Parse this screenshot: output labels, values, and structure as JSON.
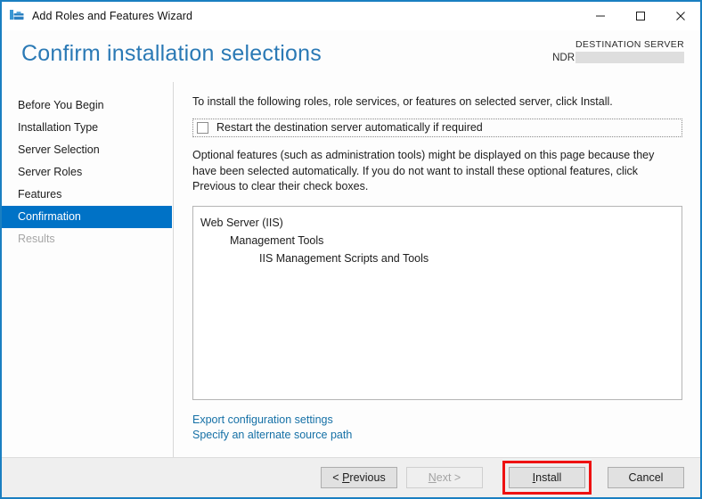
{
  "window": {
    "title": "Add Roles and Features Wizard",
    "icon": "roles-features-toolbox-icon",
    "accent_color": "#1a7fc1",
    "controls": {
      "minimize": "minimize-icon",
      "maximize": "maximize-icon",
      "close": "close-icon"
    }
  },
  "header": {
    "page_title": "Confirm installation selections",
    "destination_label": "DESTINATION SERVER",
    "destination_server": "NDR",
    "destination_redacted": true
  },
  "sidebar": {
    "items": [
      {
        "label": "Before You Begin",
        "state": "normal"
      },
      {
        "label": "Installation Type",
        "state": "normal"
      },
      {
        "label": "Server Selection",
        "state": "normal"
      },
      {
        "label": "Server Roles",
        "state": "normal"
      },
      {
        "label": "Features",
        "state": "normal"
      },
      {
        "label": "Confirmation",
        "state": "selected"
      },
      {
        "label": "Results",
        "state": "disabled"
      }
    ],
    "selected_color": "#0072c6"
  },
  "content": {
    "intro_text": "To install the following roles, role services, or features on selected server, click Install.",
    "restart_checkbox": {
      "label": "Restart the destination server automatically if required",
      "checked": false,
      "focused": true
    },
    "optional_text": "Optional features (such as administration tools) might be displayed on this page because they have been selected automatically. If you do not want to install these optional features, click Previous to clear their check boxes.",
    "features_list": [
      {
        "label": "Web Server (IIS)",
        "level": 0
      },
      {
        "label": "Management Tools",
        "level": 1
      },
      {
        "label": "IIS Management Scripts and Tools",
        "level": 2
      }
    ],
    "links": [
      "Export configuration settings",
      "Specify an alternate source path"
    ]
  },
  "footer": {
    "buttons": [
      {
        "label": "< Previous",
        "accel": "P",
        "state": "enabled"
      },
      {
        "label": "Next >",
        "accel": "N",
        "state": "disabled"
      },
      {
        "label": "Install",
        "accel": "I",
        "state": "enabled",
        "highlighted": true
      },
      {
        "label": "Cancel",
        "accel": "",
        "state": "enabled"
      }
    ],
    "highlight_color": "#ee1111"
  }
}
